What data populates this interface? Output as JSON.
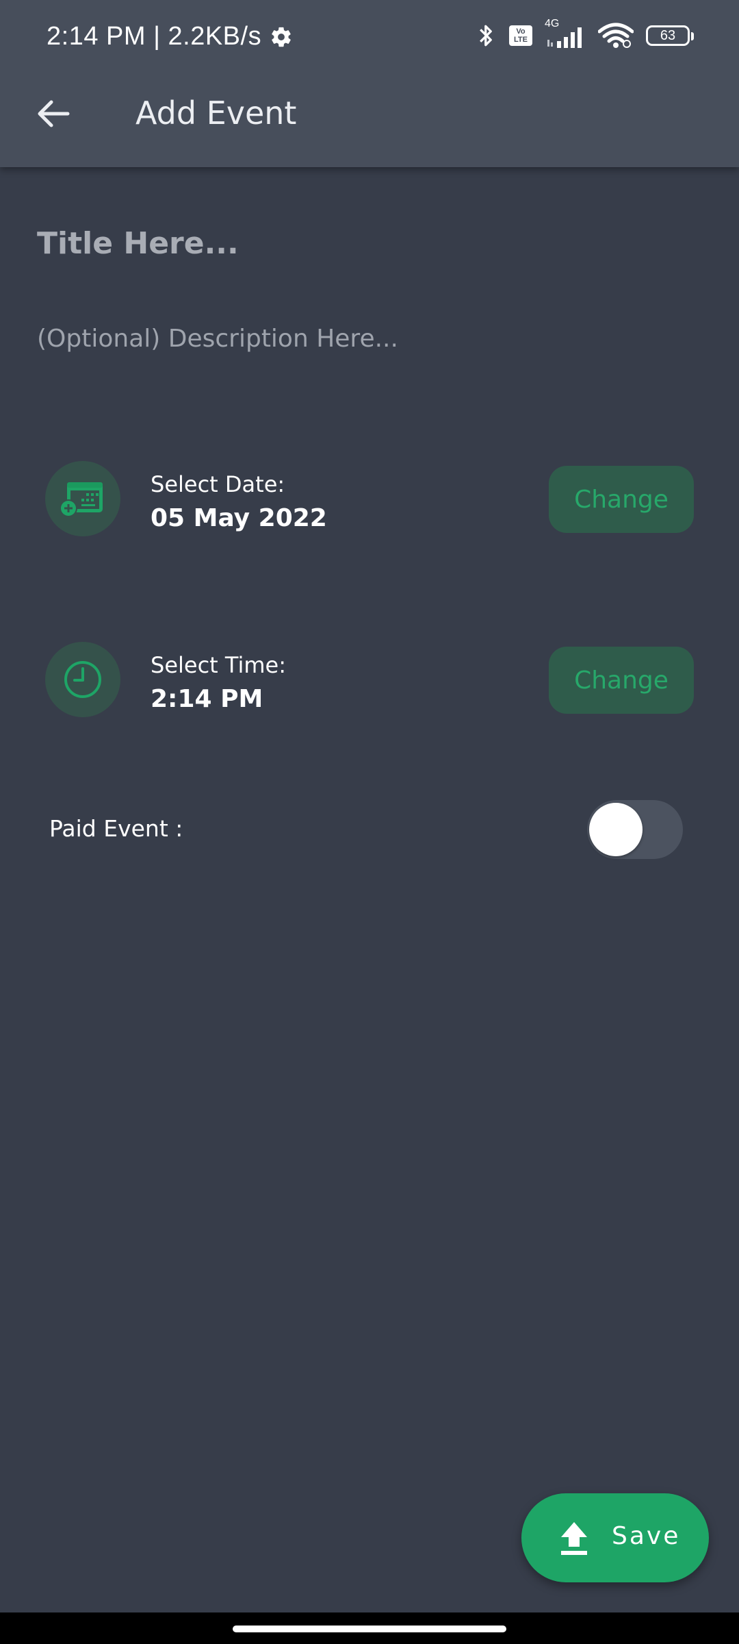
{
  "status_bar": {
    "time_speed": "2:14 PM | 2.2KB/s",
    "network_type": "4G",
    "volte_label": "Vo LTE",
    "battery": "63"
  },
  "app_bar": {
    "title": "Add Event"
  },
  "form": {
    "title_placeholder": "Title Here...",
    "description_placeholder": "(Optional) Description Here..."
  },
  "date_row": {
    "label": "Select Date:",
    "value": "05 May 2022",
    "button": "Change"
  },
  "time_row": {
    "label": "Select Time:",
    "value": "2:14 PM",
    "button": "Change"
  },
  "paid_event": {
    "label": "Paid Event :",
    "enabled": false
  },
  "fab": {
    "label": "Save"
  },
  "colors": {
    "background": "#373d4a",
    "app_bar": "#474e5b",
    "accent_green": "#1ea566",
    "icon_circle": "#35524b",
    "change_button_bg": "#2f5c4b",
    "change_button_text": "#27a86a"
  }
}
